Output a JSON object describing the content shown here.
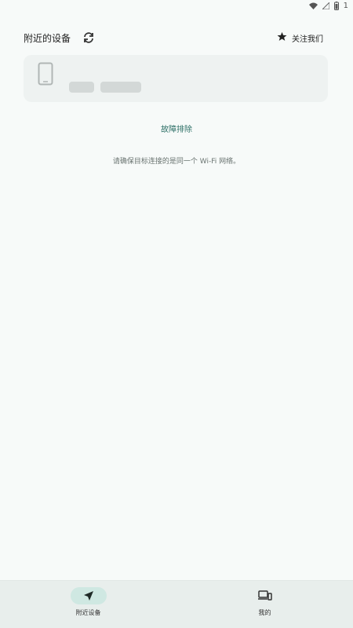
{
  "status_bar": {
    "battery_text": "1",
    "icons": [
      "wifi-icon",
      "signal-icon",
      "battery-icon"
    ]
  },
  "header": {
    "title": "附近的设备",
    "refresh_icon": "refresh-icon",
    "follow_label": "关注我们",
    "follow_icon": "star-icon"
  },
  "device_card": {
    "icon": "smartphone-icon"
  },
  "troubleshoot_label": "故障排除",
  "hint_text": "请确保目标连接的是同一个 Wi-Fi 网络。",
  "bottom_nav": {
    "items": [
      {
        "label": "附近设备",
        "icon": "navigation-arrow-icon",
        "active": true
      },
      {
        "label": "我的",
        "icon": "devices-icon",
        "active": false
      }
    ]
  },
  "colors": {
    "accent": "#2c6f66",
    "active_pill": "#cfe8e2",
    "background": "#f7faf9",
    "nav_background": "#e8eeec"
  }
}
